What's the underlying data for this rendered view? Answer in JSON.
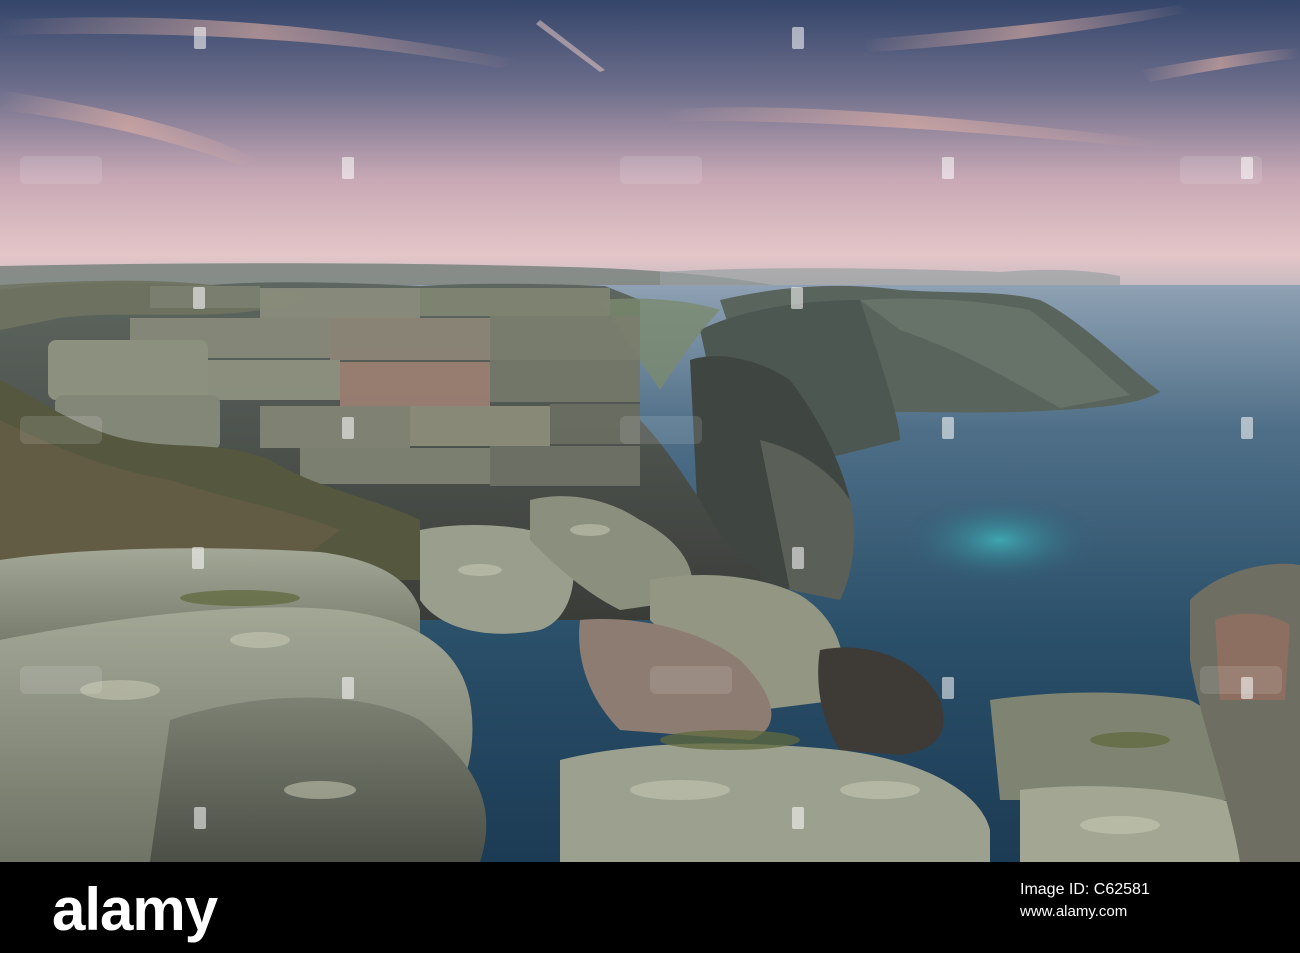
{
  "watermark": {
    "text": "alamy",
    "color": "#ffffff"
  },
  "footer": {
    "brand": "alamy",
    "image_id_label": "Image ID: C62581",
    "url": "www.alamy.com"
  },
  "colors": {
    "sky_top": "#3b4f71",
    "sky_horizon": "#e7c4c4",
    "sea": "#2c526d",
    "sea_turquoise": "#39a8b2",
    "granite": "#8f9384",
    "footer_bg": "#000000"
  }
}
